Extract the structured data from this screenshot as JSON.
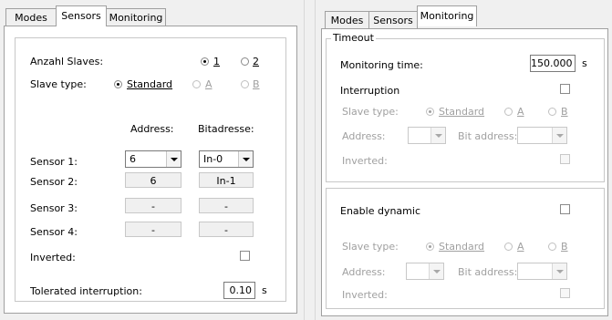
{
  "left": {
    "tabs": [
      "Modes",
      "Sensors",
      "Monitoring"
    ],
    "active_tab": "Sensors",
    "anzahl_slaves": {
      "label": "Anzahl Slaves:",
      "options": [
        "1",
        "2"
      ],
      "selected": "1"
    },
    "slave_type": {
      "label": "Slave type:",
      "options": [
        "Standard",
        "A",
        "B"
      ],
      "selected": "Standard"
    },
    "col_address": "Address:",
    "col_bitadresse": "Bitadresse:",
    "sensors": [
      {
        "label": "Sensor 1:",
        "address": "6",
        "bit": "In-0"
      },
      {
        "label": "Sensor 2:",
        "address": "6",
        "bit": "In-1"
      },
      {
        "label": "Sensor 3:",
        "address": "-",
        "bit": "-"
      },
      {
        "label": "Sensor 4:",
        "address": "-",
        "bit": "-"
      }
    ],
    "inverted_label": "Inverted:",
    "tolerated_label": "Tolerated interruption:",
    "tolerated_value": "0.10",
    "tolerated_unit": "s"
  },
  "right": {
    "tabs": [
      "Modes",
      "Sensors",
      "Monitoring"
    ],
    "active_tab": "Monitoring",
    "timeout_legend": "Timeout",
    "monitoring_time_label": "Monitoring time:",
    "monitoring_time_value": "150.000",
    "monitoring_time_unit": "s",
    "interruption_label": "Interruption",
    "slave_type_label": "Slave type:",
    "slave_type_options": [
      "Standard",
      "A",
      "B"
    ],
    "address_label": "Address:",
    "bit_address_label": "Bit address:",
    "inverted_label": "Inverted:",
    "enable_dynamic_label": "Enable dynamic"
  }
}
